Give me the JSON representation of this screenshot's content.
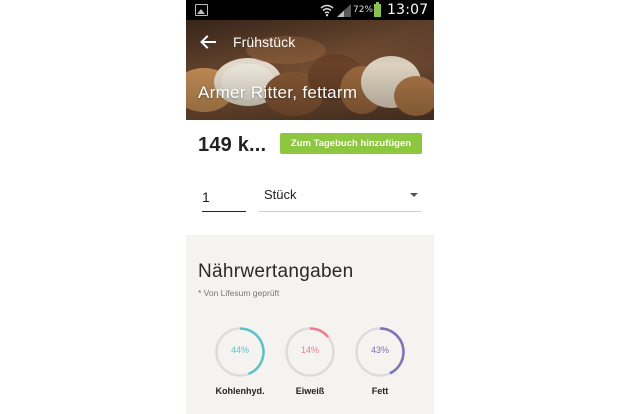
{
  "status_bar": {
    "battery_percent": "72%",
    "time": "13:07"
  },
  "toolbar": {
    "title": "Frühstück"
  },
  "food": {
    "title": "Armer Ritter, fettarm",
    "calories": "149 k...",
    "add_button_label": "Zum Tagebuch hinzufügen"
  },
  "quantity": {
    "value": "1",
    "unit": "Stück"
  },
  "nutrition": {
    "title": "Nährwertangaben",
    "verified_note": "* Von Lifesum geprüft",
    "macros": [
      {
        "label": "Kohlenhyd.",
        "percent_text": "44%",
        "fraction": 0.44,
        "color": "#5bc4c8"
      },
      {
        "label": "Eiweiß",
        "percent_text": "14%",
        "fraction": 0.14,
        "color": "#ef7b8e"
      },
      {
        "label": "Fett",
        "percent_text": "43%",
        "fraction": 0.43,
        "color": "#7a74b8"
      }
    ]
  },
  "colors": {
    "accent_green": "#8dc63f",
    "panel_background": "#f4f3ef",
    "ring_track": "#dcdcdc"
  }
}
